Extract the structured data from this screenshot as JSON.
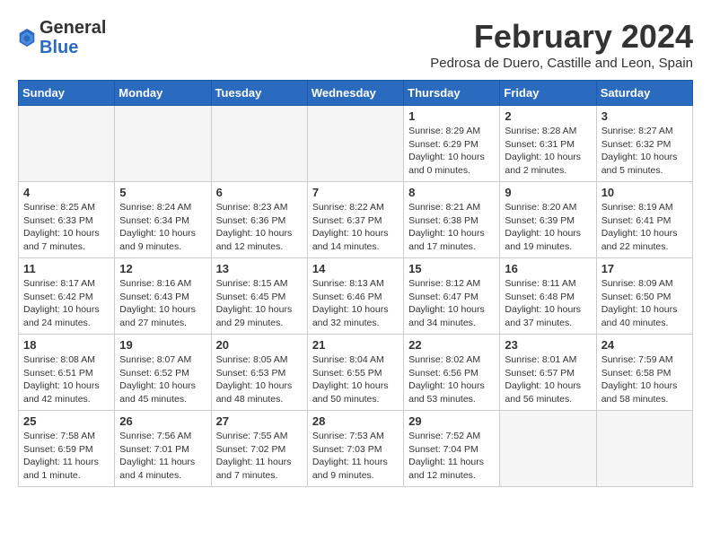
{
  "header": {
    "logo_general": "General",
    "logo_blue": "Blue",
    "month_title": "February 2024",
    "location": "Pedrosa de Duero, Castille and Leon, Spain"
  },
  "weekdays": [
    "Sunday",
    "Monday",
    "Tuesday",
    "Wednesday",
    "Thursday",
    "Friday",
    "Saturday"
  ],
  "weeks": [
    [
      {
        "day": "",
        "info": ""
      },
      {
        "day": "",
        "info": ""
      },
      {
        "day": "",
        "info": ""
      },
      {
        "day": "",
        "info": ""
      },
      {
        "day": "1",
        "info": "Sunrise: 8:29 AM\nSunset: 6:29 PM\nDaylight: 10 hours\nand 0 minutes."
      },
      {
        "day": "2",
        "info": "Sunrise: 8:28 AM\nSunset: 6:31 PM\nDaylight: 10 hours\nand 2 minutes."
      },
      {
        "day": "3",
        "info": "Sunrise: 8:27 AM\nSunset: 6:32 PM\nDaylight: 10 hours\nand 5 minutes."
      }
    ],
    [
      {
        "day": "4",
        "info": "Sunrise: 8:25 AM\nSunset: 6:33 PM\nDaylight: 10 hours\nand 7 minutes."
      },
      {
        "day": "5",
        "info": "Sunrise: 8:24 AM\nSunset: 6:34 PM\nDaylight: 10 hours\nand 9 minutes."
      },
      {
        "day": "6",
        "info": "Sunrise: 8:23 AM\nSunset: 6:36 PM\nDaylight: 10 hours\nand 12 minutes."
      },
      {
        "day": "7",
        "info": "Sunrise: 8:22 AM\nSunset: 6:37 PM\nDaylight: 10 hours\nand 14 minutes."
      },
      {
        "day": "8",
        "info": "Sunrise: 8:21 AM\nSunset: 6:38 PM\nDaylight: 10 hours\nand 17 minutes."
      },
      {
        "day": "9",
        "info": "Sunrise: 8:20 AM\nSunset: 6:39 PM\nDaylight: 10 hours\nand 19 minutes."
      },
      {
        "day": "10",
        "info": "Sunrise: 8:19 AM\nSunset: 6:41 PM\nDaylight: 10 hours\nand 22 minutes."
      }
    ],
    [
      {
        "day": "11",
        "info": "Sunrise: 8:17 AM\nSunset: 6:42 PM\nDaylight: 10 hours\nand 24 minutes."
      },
      {
        "day": "12",
        "info": "Sunrise: 8:16 AM\nSunset: 6:43 PM\nDaylight: 10 hours\nand 27 minutes."
      },
      {
        "day": "13",
        "info": "Sunrise: 8:15 AM\nSunset: 6:45 PM\nDaylight: 10 hours\nand 29 minutes."
      },
      {
        "day": "14",
        "info": "Sunrise: 8:13 AM\nSunset: 6:46 PM\nDaylight: 10 hours\nand 32 minutes."
      },
      {
        "day": "15",
        "info": "Sunrise: 8:12 AM\nSunset: 6:47 PM\nDaylight: 10 hours\nand 34 minutes."
      },
      {
        "day": "16",
        "info": "Sunrise: 8:11 AM\nSunset: 6:48 PM\nDaylight: 10 hours\nand 37 minutes."
      },
      {
        "day": "17",
        "info": "Sunrise: 8:09 AM\nSunset: 6:50 PM\nDaylight: 10 hours\nand 40 minutes."
      }
    ],
    [
      {
        "day": "18",
        "info": "Sunrise: 8:08 AM\nSunset: 6:51 PM\nDaylight: 10 hours\nand 42 minutes."
      },
      {
        "day": "19",
        "info": "Sunrise: 8:07 AM\nSunset: 6:52 PM\nDaylight: 10 hours\nand 45 minutes."
      },
      {
        "day": "20",
        "info": "Sunrise: 8:05 AM\nSunset: 6:53 PM\nDaylight: 10 hours\nand 48 minutes."
      },
      {
        "day": "21",
        "info": "Sunrise: 8:04 AM\nSunset: 6:55 PM\nDaylight: 10 hours\nand 50 minutes."
      },
      {
        "day": "22",
        "info": "Sunrise: 8:02 AM\nSunset: 6:56 PM\nDaylight: 10 hours\nand 53 minutes."
      },
      {
        "day": "23",
        "info": "Sunrise: 8:01 AM\nSunset: 6:57 PM\nDaylight: 10 hours\nand 56 minutes."
      },
      {
        "day": "24",
        "info": "Sunrise: 7:59 AM\nSunset: 6:58 PM\nDaylight: 10 hours\nand 58 minutes."
      }
    ],
    [
      {
        "day": "25",
        "info": "Sunrise: 7:58 AM\nSunset: 6:59 PM\nDaylight: 11 hours\nand 1 minute."
      },
      {
        "day": "26",
        "info": "Sunrise: 7:56 AM\nSunset: 7:01 PM\nDaylight: 11 hours\nand 4 minutes."
      },
      {
        "day": "27",
        "info": "Sunrise: 7:55 AM\nSunset: 7:02 PM\nDaylight: 11 hours\nand 7 minutes."
      },
      {
        "day": "28",
        "info": "Sunrise: 7:53 AM\nSunset: 7:03 PM\nDaylight: 11 hours\nand 9 minutes."
      },
      {
        "day": "29",
        "info": "Sunrise: 7:52 AM\nSunset: 7:04 PM\nDaylight: 11 hours\nand 12 minutes."
      },
      {
        "day": "",
        "info": ""
      },
      {
        "day": "",
        "info": ""
      }
    ]
  ]
}
